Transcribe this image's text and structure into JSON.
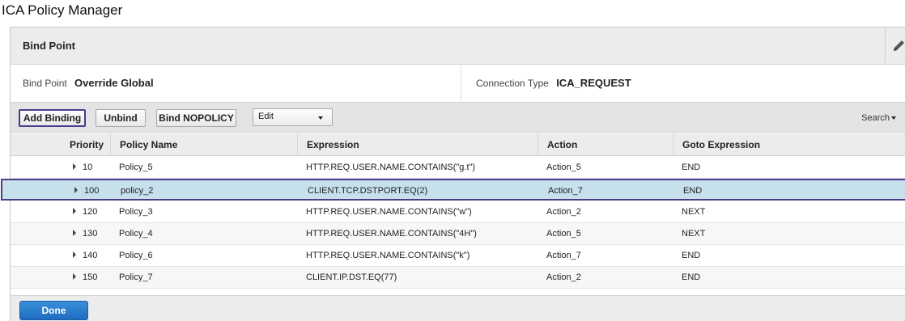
{
  "page": {
    "title": "ICA Policy Manager"
  },
  "bind_point_panel": {
    "title": "Bind Point",
    "bind_point_label": "Bind Point",
    "bind_point_value": "Override Global",
    "connection_type_label": "Connection Type",
    "connection_type_value": "ICA_REQUEST"
  },
  "toolbar": {
    "add_binding": "Add Binding",
    "unbind": "Unbind",
    "bind_nopolicy": "Bind NOPOLICY",
    "edit_select_value": "Edit",
    "search": "Search"
  },
  "grid": {
    "columns": [
      "Priority",
      "Policy Name",
      "Expression",
      "Action",
      "Goto Expression"
    ],
    "rows": [
      {
        "priority": "10",
        "policy_name": "Policy_5",
        "expression": "HTTP.REQ.USER.NAME.CONTAINS(\"g.t\")",
        "action": "Action_5",
        "goto": "END"
      },
      {
        "priority": "100",
        "policy_name": "policy_2",
        "expression": "CLIENT.TCP.DSTPORT.EQ(2)",
        "action": "Action_7",
        "goto": "END"
      },
      {
        "priority": "120",
        "policy_name": "Policy_3",
        "expression": "HTTP.REQ.USER.NAME.CONTAINS(\"w\")",
        "action": "Action_2",
        "goto": "NEXT"
      },
      {
        "priority": "130",
        "policy_name": "Policy_4",
        "expression": "HTTP.REQ.USER.NAME.CONTAINS(\"4H\")",
        "action": "Action_5",
        "goto": "NEXT"
      },
      {
        "priority": "140",
        "policy_name": "Policy_6",
        "expression": "HTTP.REQ.USER.NAME.CONTAINS(\"k\")",
        "action": "Action_7",
        "goto": "END"
      },
      {
        "priority": "150",
        "policy_name": "Policy_7",
        "expression": "CLIENT.IP.DST.EQ(77)",
        "action": "Action_2",
        "goto": "END"
      }
    ]
  },
  "footer": {
    "done": "Done"
  },
  "colors": {
    "selected_row": "#c6e0ec",
    "highlight_border": "#4e3a8a",
    "done_button": "#2a7bcc"
  },
  "icons": {
    "edit": "pencil-icon",
    "expand": "triangle-right-icon",
    "dropdown": "chevron-down-icon"
  }
}
